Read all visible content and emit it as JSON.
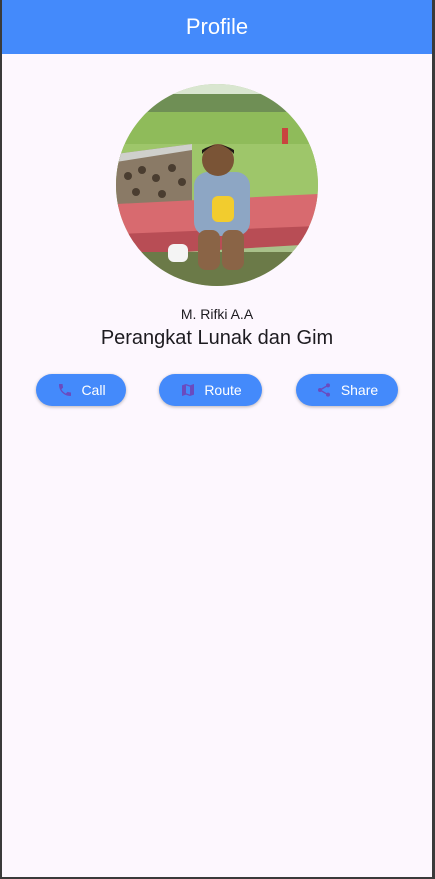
{
  "app_bar": {
    "title": "Profile",
    "color": "#448afb"
  },
  "profile": {
    "name": "M. Rifki A.A",
    "subtitle": "Perangkat Lunak dan Gim"
  },
  "actions": [
    {
      "label": "Call",
      "icon": "phone-icon"
    },
    {
      "label": "Route",
      "icon": "map-icon"
    },
    {
      "label": "Share",
      "icon": "share-icon"
    }
  ],
  "colors": {
    "accent": "#448afb",
    "icon_tint": "#6a4bbf",
    "background": "#fdf7fe"
  }
}
